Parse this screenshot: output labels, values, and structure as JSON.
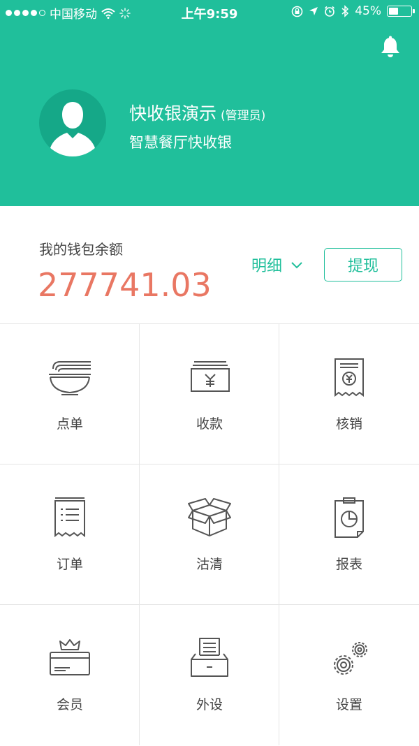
{
  "status_bar": {
    "carrier": "中国移动",
    "time": "上午9:59",
    "battery": "45%"
  },
  "profile": {
    "name": "快收银演示",
    "role": "(管理员)",
    "store": "智慧餐厅快收银"
  },
  "wallet": {
    "label": "我的钱包余额",
    "balance": "277741.03",
    "detail_label": "明细",
    "withdraw_label": "提现"
  },
  "menu": [
    {
      "label": "点单",
      "icon": "noodle-bowl-icon"
    },
    {
      "label": "收款",
      "icon": "cash-icon"
    },
    {
      "label": "核销",
      "icon": "receipt-yen-icon"
    },
    {
      "label": "订单",
      "icon": "order-list-icon"
    },
    {
      "label": "沽清",
      "icon": "open-box-icon"
    },
    {
      "label": "报表",
      "icon": "report-chart-icon"
    },
    {
      "label": "会员",
      "icon": "member-card-icon"
    },
    {
      "label": "外设",
      "icon": "printer-icon"
    },
    {
      "label": "设置",
      "icon": "gears-icon"
    }
  ],
  "colors": {
    "accent": "#20bf9b",
    "balance": "#e97763"
  }
}
